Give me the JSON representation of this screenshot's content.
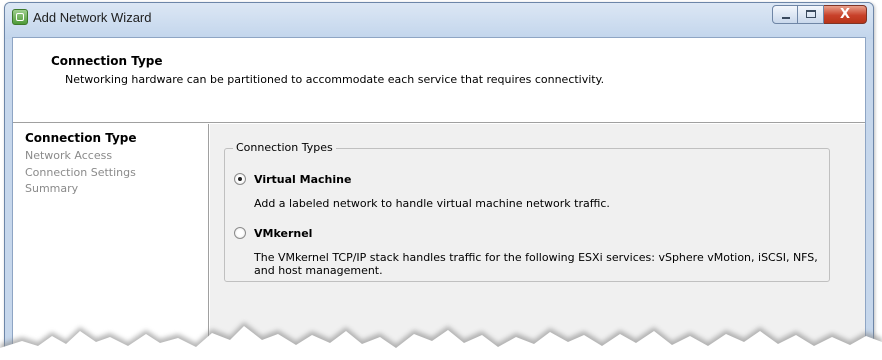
{
  "window": {
    "title": "Add Network Wizard",
    "icon": "vsphere-wizard-icon",
    "controls": {
      "minimize": "minimize-icon",
      "maximize": "maximize-icon",
      "close": "close-icon",
      "close_glyph": "X"
    }
  },
  "header": {
    "title": "Connection Type",
    "subtitle": "Networking hardware can be partitioned to accommodate each service that requires connectivity."
  },
  "steps": [
    {
      "label": "Connection Type",
      "active": true
    },
    {
      "label": "Network Access",
      "active": false
    },
    {
      "label": "Connection Settings",
      "active": false
    },
    {
      "label": "Summary",
      "active": false
    }
  ],
  "connection_types": {
    "group_title": "Connection Types",
    "options": [
      {
        "label": "Virtual Machine",
        "selected": true,
        "description": "Add a labeled network to handle virtual machine network traffic."
      },
      {
        "label": "VMkernel",
        "selected": false,
        "description_line1": "The VMkernel TCP/IP stack handles traffic for the following ESXi services: vSphere vMotion, iSCSI, NFS,",
        "description_line2": "and host management."
      }
    ]
  },
  "colors": {
    "titlebar": "#c6d7ec",
    "close_button": "#c8412a",
    "content_bg": "#f0f0f0",
    "inactive_step": "#8a8a8a"
  }
}
